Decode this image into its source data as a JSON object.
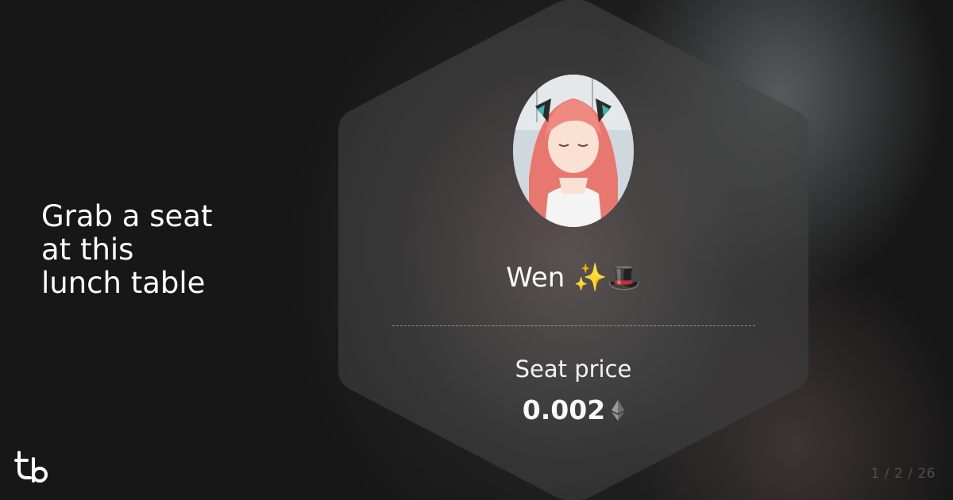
{
  "tagline": "Grab a seat\nat this\nlunch table",
  "card": {
    "name": "Wen ✨🎩",
    "price_label": "Seat price",
    "price_value": "0.002",
    "currency_icon": "ethereum-icon"
  },
  "footer": {
    "logo_icon": "brand-logo-icon",
    "page_counter": "1 / 2 / 26"
  }
}
